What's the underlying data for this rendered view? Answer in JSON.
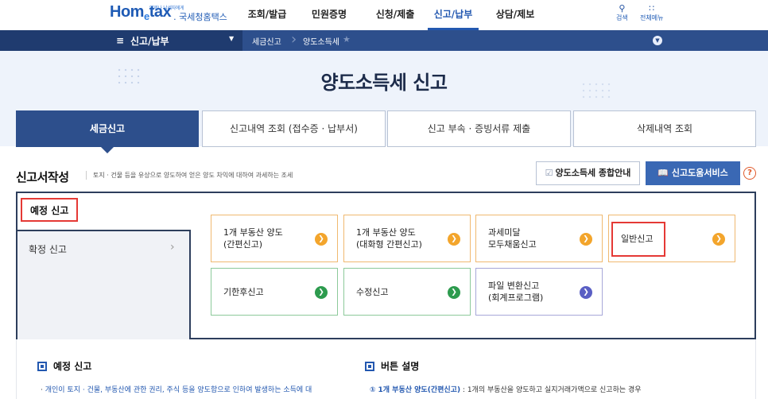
{
  "header": {
    "logo_small": "언제나 납세자에게",
    "logo_main_a": "Hom",
    "logo_main_e": "e",
    "logo_main_b": "tax",
    "logo_sub": ". 국세청홈택스",
    "nav": [
      "조회/발급",
      "민원증명",
      "신청/제출",
      "신고/납부",
      "상담/제보"
    ],
    "active_nav": "신고/납부",
    "search_label": "검색",
    "allmenu_label": "전체메뉴"
  },
  "navbar": {
    "menu_label": "신고/납부",
    "breadcrumb": [
      "세금신고",
      "양도소득세"
    ]
  },
  "hero": {
    "title": "양도소득세 신고"
  },
  "tabs": [
    "세금신고",
    "신고내역 조회 (접수증 · 납부서)",
    "신고 부속 · 증빙서류 제출",
    "삭제내역 조회"
  ],
  "section": {
    "title": "신고서작성",
    "desc": "토지 · 건물 등을 유상으로 양도하여 얻은 양도 차익에 대하여 과세하는 조세",
    "guide_button": "양도소득세 종합안내",
    "help_button": "신고도움서비스",
    "help_icon": "?"
  },
  "side_menu": {
    "active": "예정 신고",
    "item": "확정 신고"
  },
  "cards": [
    {
      "line1": "1개 부동산 양도",
      "line2": "(간편신고)"
    },
    {
      "line1": "1개 부동산 양도",
      "line2": "(대화형 간편신고)"
    },
    {
      "line1": "과세미달",
      "line2": "모두채움신고"
    },
    {
      "line1": "일반신고",
      "line2": ""
    },
    {
      "line1": "기한후신고",
      "line2": ""
    },
    {
      "line1": "수정신고",
      "line2": ""
    },
    {
      "line1": "파일 변환신고",
      "line2": "(회계프로그램)"
    }
  ],
  "info": {
    "left_title": "예정 신고",
    "left_text": "개인이 토지 · 건물, 부동산에 관한 권리, 주식 등을 양도함으로 인하여 발생하는 소득에 대",
    "right_title": "버튼 설명",
    "right_num": "①",
    "right_bold": "1개 부동산 양도(간편신고)",
    "right_text": " : 1개의 부동산을 양도하고 실지거래가액으로 신고하는 경우"
  },
  "colors": {
    "primary": "#2d4f8c",
    "accent_blue": "#2358b0",
    "highlight_red": "#e53935",
    "orange": "#f3a52c",
    "green": "#2d9b4e",
    "purple": "#5a5fc4"
  }
}
